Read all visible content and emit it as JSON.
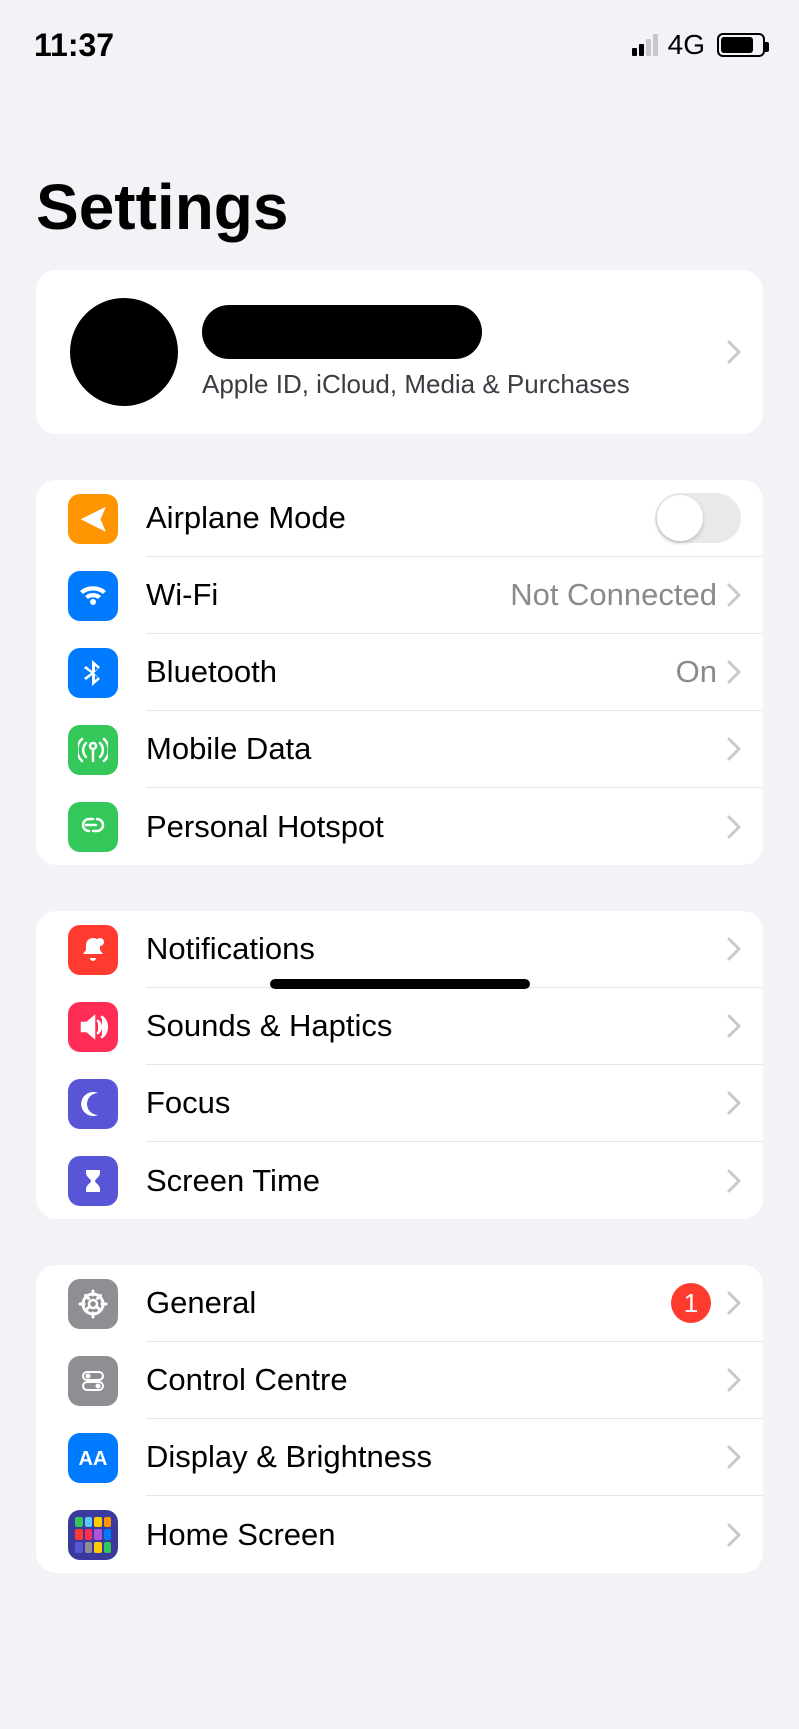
{
  "status": {
    "time": "11:37",
    "network": "4G",
    "signal_bars_filled": 2,
    "battery_pct": 80
  },
  "title": "Settings",
  "profile": {
    "name_redacted": true,
    "subtitle": "Apple ID, iCloud, Media & Purchases"
  },
  "groups": [
    {
      "rows": [
        {
          "id": "airplane",
          "label": "Airplane Mode",
          "icon": "airplane-icon",
          "color": "c-orange",
          "type": "switch",
          "switch_on": false
        },
        {
          "id": "wifi",
          "label": "Wi-Fi",
          "icon": "wifi-icon",
          "color": "c-blue",
          "type": "link",
          "value": "Not Connected"
        },
        {
          "id": "bluetooth",
          "label": "Bluetooth",
          "icon": "bluetooth-icon",
          "color": "c-blue",
          "type": "link",
          "value": "On"
        },
        {
          "id": "mobile-data",
          "label": "Mobile Data",
          "icon": "antenna-icon",
          "color": "c-green",
          "type": "link"
        },
        {
          "id": "hotspot",
          "label": "Personal Hotspot",
          "icon": "link-icon",
          "color": "c-green",
          "type": "link"
        }
      ]
    },
    {
      "rows": [
        {
          "id": "notifications",
          "label": "Notifications",
          "icon": "bell-icon",
          "color": "c-red",
          "type": "link"
        },
        {
          "id": "sounds",
          "label": "Sounds & Haptics",
          "icon": "speaker-icon",
          "color": "c-pink",
          "type": "link"
        },
        {
          "id": "focus",
          "label": "Focus",
          "icon": "moon-icon",
          "color": "c-indigo",
          "type": "link"
        },
        {
          "id": "screen-time",
          "label": "Screen Time",
          "icon": "hourglass-icon",
          "color": "c-indigo",
          "type": "link"
        }
      ]
    },
    {
      "rows": [
        {
          "id": "general",
          "label": "General",
          "icon": "gear-icon",
          "color": "c-gray",
          "type": "link",
          "badge": "1"
        },
        {
          "id": "control-centre",
          "label": "Control Centre",
          "icon": "switches-icon",
          "color": "c-gray",
          "type": "link"
        },
        {
          "id": "display",
          "label": "Display & Brightness",
          "icon": "aa-icon",
          "color": "c-blue",
          "type": "link"
        },
        {
          "id": "home-screen",
          "label": "Home Screen",
          "icon": "homegrid-icon",
          "color": "c-home",
          "type": "link"
        }
      ]
    }
  ]
}
